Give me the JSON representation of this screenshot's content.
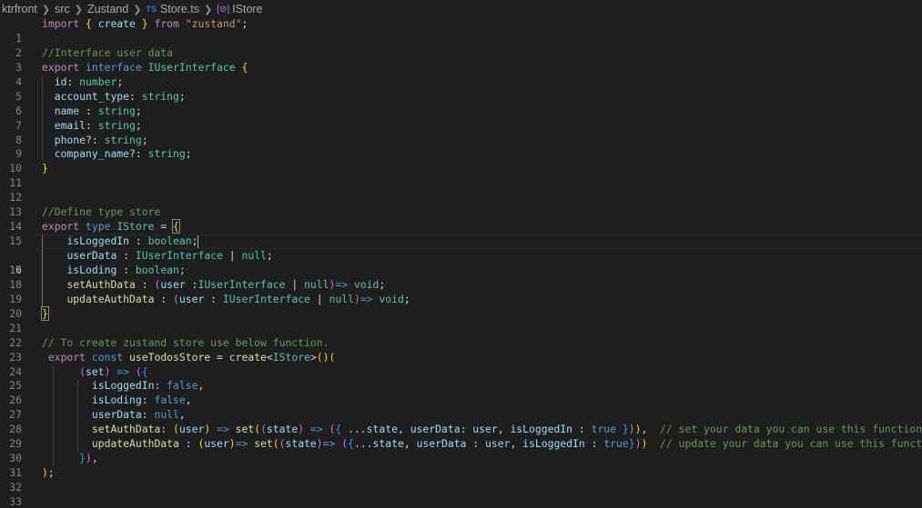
{
  "breadcrumb": {
    "items": [
      "ktrfront",
      "src",
      "Zustand",
      "Store.ts",
      "IStore"
    ],
    "file_badge": "TS",
    "symbol_badge": "[⊘]"
  },
  "editor": {
    "active_line": 16,
    "line_numbers": [
      "1",
      "2",
      "3",
      "4",
      "5",
      "6",
      "7",
      "8",
      "9",
      "10",
      "11",
      "12",
      "13",
      "14",
      "15",
      "16",
      "17",
      "18",
      "19",
      "20",
      "21",
      "22",
      "23",
      "24",
      "25",
      "26",
      "27",
      "28",
      "29",
      "30",
      "31",
      "32",
      "33"
    ],
    "code": {
      "l1": [
        "import",
        " { ",
        "create",
        " } ",
        "from",
        " ",
        "\"zustand\"",
        ";"
      ],
      "l3": "//Interface user data",
      "l4": [
        "export",
        " ",
        "interface",
        " ",
        "IUserInterface",
        " ",
        "{"
      ],
      "l5": [
        "id",
        ": ",
        "number",
        ";"
      ],
      "l6": [
        "account_type",
        ": ",
        "string",
        ";"
      ],
      "l7": [
        "name",
        " : ",
        "string",
        ";"
      ],
      "l8": [
        "email",
        ": ",
        "string",
        ";"
      ],
      "l9": [
        "phone",
        "?: ",
        "string",
        ";"
      ],
      "l10": [
        "company_name",
        "?: ",
        "string",
        ";"
      ],
      "l11": "}",
      "l14": "//Define type store",
      "l15": [
        "export",
        " ",
        "type",
        " ",
        "IStore",
        " = ",
        "{"
      ],
      "l16": [
        "isLoggedIn",
        " : ",
        "boolean",
        ";"
      ],
      "l17": [
        "userData",
        " : ",
        "IUserInterface",
        " | ",
        "null",
        ";"
      ],
      "l18": [
        "isLoding",
        " : ",
        "boolean",
        ";"
      ],
      "l19": [
        "setAuthData",
        " : ",
        "(",
        "user",
        " :",
        "IUserInterface",
        " | ",
        "null",
        ")",
        "=>",
        " ",
        "void",
        ";"
      ],
      "l20": [
        "updateAuthData",
        " : ",
        "(",
        "user",
        " : ",
        "IUserInterface",
        " | ",
        "null",
        ")",
        "=>",
        " ",
        "void",
        ";"
      ],
      "l21": "}",
      "l23": "// To create zustand store use below function.",
      "l24": [
        "export",
        " ",
        "const",
        " ",
        "useTodosStore",
        " = ",
        "create",
        "<",
        "IStore",
        ">",
        "()",
        "("
      ],
      "l25": [
        "(",
        "set",
        ")",
        " => ",
        "(",
        "{"
      ],
      "l26": [
        "isLoggedIn",
        ": ",
        "false",
        ","
      ],
      "l27": [
        "isLoding",
        ": ",
        "false",
        ","
      ],
      "l28": [
        "userData",
        ": ",
        "null",
        ","
      ],
      "l29": [
        "setAuthData",
        ": ",
        "(",
        "user",
        ")",
        " => ",
        "set",
        "(",
        "(",
        "state",
        ")",
        " => ",
        "(",
        "{",
        " ...",
        "state",
        ", ",
        "userData",
        ": ",
        "user",
        ", ",
        "isLoggedIn",
        " : ",
        "true",
        " ",
        "}",
        ")",
        ")",
        ",",
        "  ",
        "// set your data you can use this function."
      ],
      "l30": [
        "updateAuthData",
        " : ",
        "(",
        "user",
        ")",
        "=> ",
        "set",
        "(",
        "(",
        "state",
        ")",
        "=> ",
        "(",
        "{",
        "...",
        "state",
        ", ",
        "userData",
        " : ",
        "user",
        ", ",
        "isLoggedIn",
        " : ",
        "true",
        "}",
        ")",
        ")",
        "  ",
        "// update your data you can use this function."
      ],
      "l31": [
        "}",
        ")",
        ","
      ],
      "l32": [
        ")",
        ";"
      ]
    }
  }
}
